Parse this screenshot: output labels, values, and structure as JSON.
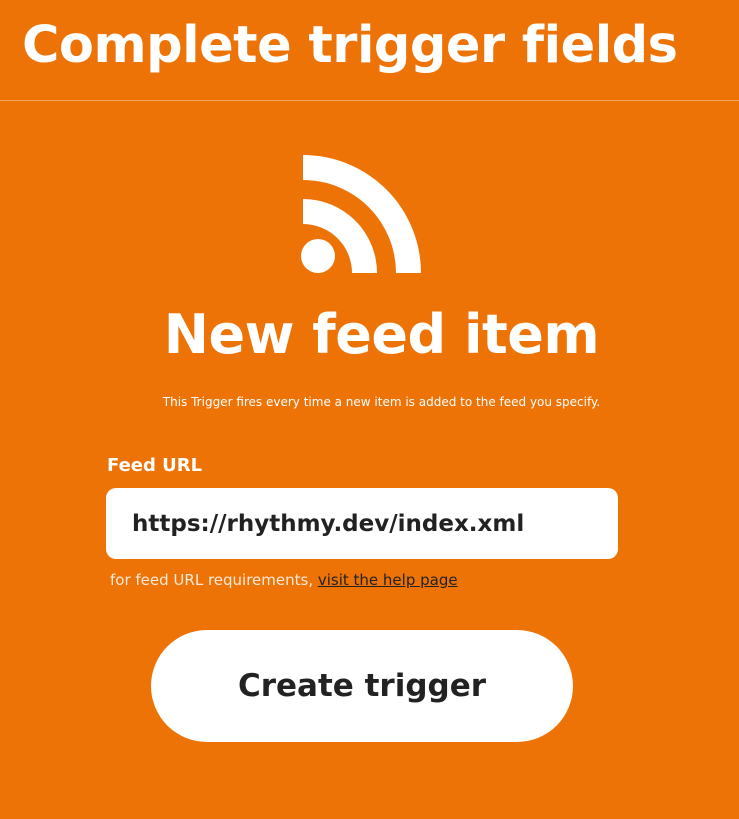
{
  "header": {
    "title": "Complete trigger fields"
  },
  "trigger": {
    "icon": "rss-feed-icon",
    "title": "New feed item",
    "description": "This Trigger fires every time a new item is added to the feed you specify."
  },
  "form": {
    "feed_url_label": "Feed URL",
    "feed_url_value": "https://rhythmy.dev/index.xml",
    "helper_prefix": "for feed URL requirements, ",
    "helper_link": "visit the help page"
  },
  "actions": {
    "create_label": "Create trigger"
  },
  "colors": {
    "background": "#ee7306",
    "text": "#ffffff",
    "button_text": "#222222"
  }
}
